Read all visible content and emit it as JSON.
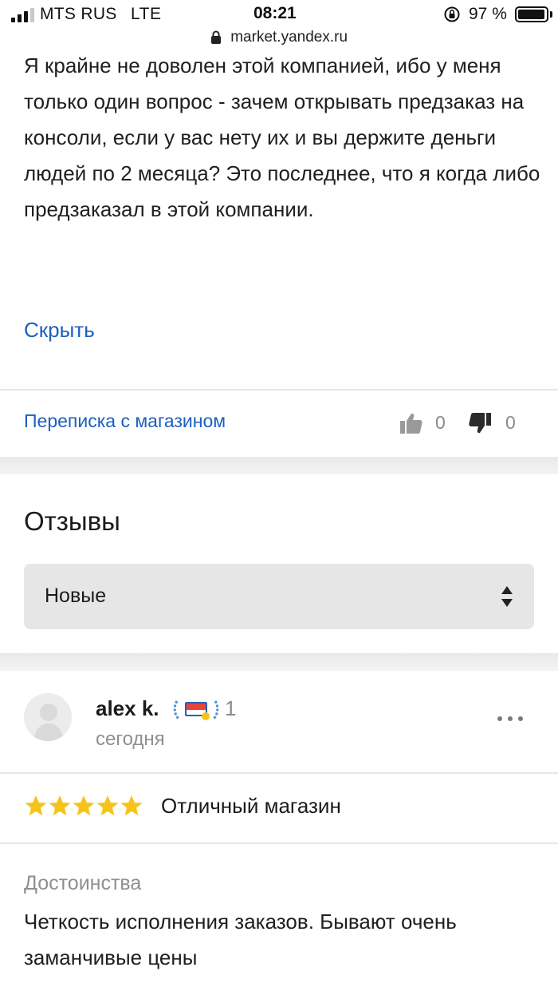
{
  "status_bar": {
    "carrier": "MTS RUS",
    "network": "LTE",
    "time": "08:21",
    "battery_percent": "97 %",
    "battery_level": 0.97
  },
  "browser": {
    "url": "market.yandex.ru",
    "lock_icon": "lock-icon"
  },
  "review_expanded": {
    "text": "Я крайне не доволен этой компанией, ибо у меня только один вопрос - зачем открывать предзаказ на консоли, если у вас нету их и вы держите деньги людей по 2 месяца? Это последнее, что я когда либо предзаказал в этой компании.",
    "hide_label": "Скрыть",
    "chat_label": "Переписка с магазином",
    "likes": "0",
    "dislikes": "0",
    "like_icon": "thumbs-up-icon",
    "dislike_icon": "thumbs-down-icon"
  },
  "reviews": {
    "title": "Отзывы",
    "sort_value": "Новые",
    "sort_icon": "sort-arrows-icon",
    "accent_color": "#1b5fbf",
    "star_color": "#f6c419"
  },
  "review": {
    "author": "alex k.",
    "badge_count": "1",
    "date": "сегодня",
    "rating": 5,
    "title": "Отличный магазин",
    "pros_label": "Достоинства",
    "pros_text": "Четкость исполнения заказов. Бывают очень заманчивые цены",
    "more_icon": "more-dots-icon"
  }
}
